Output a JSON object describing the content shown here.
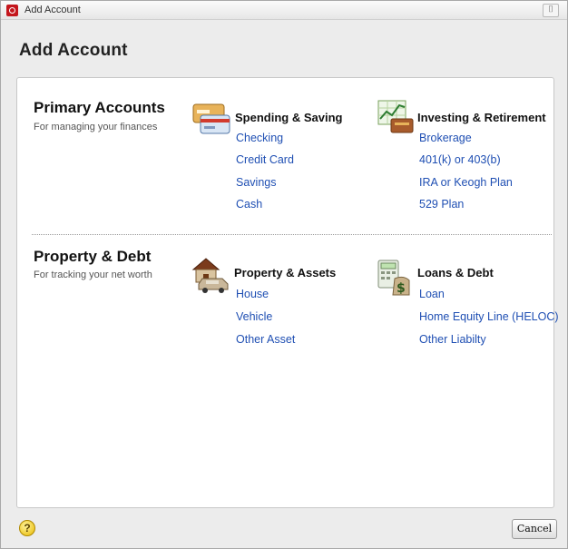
{
  "window": {
    "title": "Add Account",
    "close_glyph": "⌷"
  },
  "header": {
    "title": "Add Account"
  },
  "primary": {
    "title": "Primary Accounts",
    "subtitle": "For managing your finances",
    "spending": {
      "icon": "credit-card-icon",
      "title": "Spending & Saving",
      "links": [
        "Checking",
        "Credit Card",
        "Savings",
        "Cash"
      ]
    },
    "investing": {
      "icon": "investment-chart-icon",
      "title": "Investing & Retirement",
      "links": [
        "Brokerage",
        "401(k) or 403(b)",
        "IRA or Keogh Plan",
        "529 Plan"
      ]
    }
  },
  "property": {
    "title": "Property & Debt",
    "subtitle": "For tracking your net worth",
    "assets": {
      "icon": "house-car-icon",
      "title": "Property & Assets",
      "links": [
        "House",
        "Vehicle",
        "Other Asset"
      ]
    },
    "loans": {
      "icon": "calculator-money-icon",
      "title": "Loans & Debt",
      "links": [
        "Loan",
        "Home Equity Line (HELOC)",
        "Other Liabilty"
      ]
    }
  },
  "footer": {
    "help_glyph": "?",
    "cancel_label": "Cancel"
  }
}
